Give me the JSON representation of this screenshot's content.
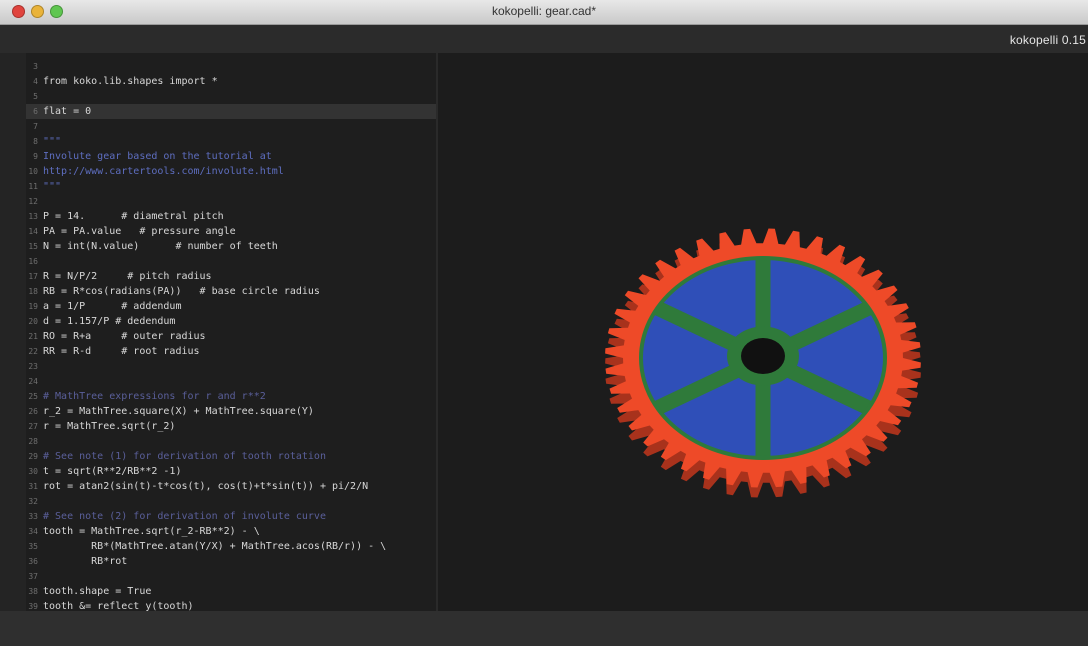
{
  "window": {
    "title": "kokopelli: gear.cad*",
    "app_version": "kokopelli 0.15"
  },
  "colors": {
    "gear_teeth": "#ee4a28",
    "gear_face": "#2f4fb8",
    "gear_spokes": "#2f7a3a",
    "editor_bg": "#1e1e1e",
    "viewport_bg": "#1c1c1c"
  },
  "editor": {
    "current_line_number": "6",
    "lines": [
      {
        "n": "3",
        "text": "",
        "style": "plain"
      },
      {
        "n": "4",
        "text": "from koko.lib.shapes import *",
        "style": "plain"
      },
      {
        "n": "5",
        "text": "",
        "style": "plain"
      },
      {
        "n": "6",
        "text": "flat = 0",
        "style": "plain"
      },
      {
        "n": "7",
        "text": "",
        "style": "plain"
      },
      {
        "n": "8",
        "text": "\"\"\"",
        "style": "doc"
      },
      {
        "n": "9",
        "text": "Involute gear based on the tutorial at",
        "style": "doc"
      },
      {
        "n": "10",
        "text": "http://www.cartertools.com/involute.html",
        "style": "doc"
      },
      {
        "n": "11",
        "text": "\"\"\"",
        "style": "doc"
      },
      {
        "n": "12",
        "text": "",
        "style": "plain"
      },
      {
        "n": "13",
        "text": "P = 14.      # diametral pitch",
        "style": "plain"
      },
      {
        "n": "14",
        "text": "PA = PA.value   # pressure angle",
        "style": "plain"
      },
      {
        "n": "15",
        "text": "N = int(N.value)      # number of teeth",
        "style": "plain"
      },
      {
        "n": "16",
        "text": "",
        "style": "plain"
      },
      {
        "n": "17",
        "text": "R = N/P/2     # pitch radius",
        "style": "plain"
      },
      {
        "n": "18",
        "text": "RB = R*cos(radians(PA))   # base circle radius",
        "style": "plain"
      },
      {
        "n": "19",
        "text": "a = 1/P      # addendum",
        "style": "plain"
      },
      {
        "n": "20",
        "text": "d = 1.157/P # dedendum",
        "style": "plain"
      },
      {
        "n": "21",
        "text": "RO = R+a     # outer radius",
        "style": "plain"
      },
      {
        "n": "22",
        "text": "RR = R-d     # root radius",
        "style": "plain"
      },
      {
        "n": "23",
        "text": "",
        "style": "plain"
      },
      {
        "n": "24",
        "text": "",
        "style": "plain"
      },
      {
        "n": "25",
        "text": "# MathTree expressions for r and r**2",
        "style": "comment"
      },
      {
        "n": "26",
        "text": "r_2 = MathTree.square(X) + MathTree.square(Y)",
        "style": "plain"
      },
      {
        "n": "27",
        "text": "r = MathTree.sqrt(r_2)",
        "style": "plain"
      },
      {
        "n": "28",
        "text": "",
        "style": "plain"
      },
      {
        "n": "29",
        "text": "# See note (1) for derivation of tooth rotation",
        "style": "comment"
      },
      {
        "n": "30",
        "text": "t = sqrt(R**2/RB**2 -1)",
        "style": "plain"
      },
      {
        "n": "31",
        "text": "rot = atan2(sin(t)-t*cos(t), cos(t)+t*sin(t)) + pi/2/N",
        "style": "plain"
      },
      {
        "n": "32",
        "text": "",
        "style": "plain"
      },
      {
        "n": "33",
        "text": "# See note (2) for derivation of involute curve",
        "style": "comment"
      },
      {
        "n": "34",
        "text": "tooth = MathTree.sqrt(r_2-RB**2) - \\",
        "style": "plain"
      },
      {
        "n": "35",
        "text": "        RB*(MathTree.atan(Y/X) + MathTree.acos(RB/r)) - \\",
        "style": "plain"
      },
      {
        "n": "36",
        "text": "        RB*rot",
        "style": "plain"
      },
      {
        "n": "37",
        "text": "",
        "style": "plain"
      },
      {
        "n": "38",
        "text": "tooth.shape = True",
        "style": "plain"
      },
      {
        "n": "39",
        "text": "tooth &= reflect_y(tooth)",
        "style": "plain"
      }
    ]
  },
  "viewport": {
    "object": "gear",
    "teeth_count": 40,
    "spoke_count": 6
  }
}
